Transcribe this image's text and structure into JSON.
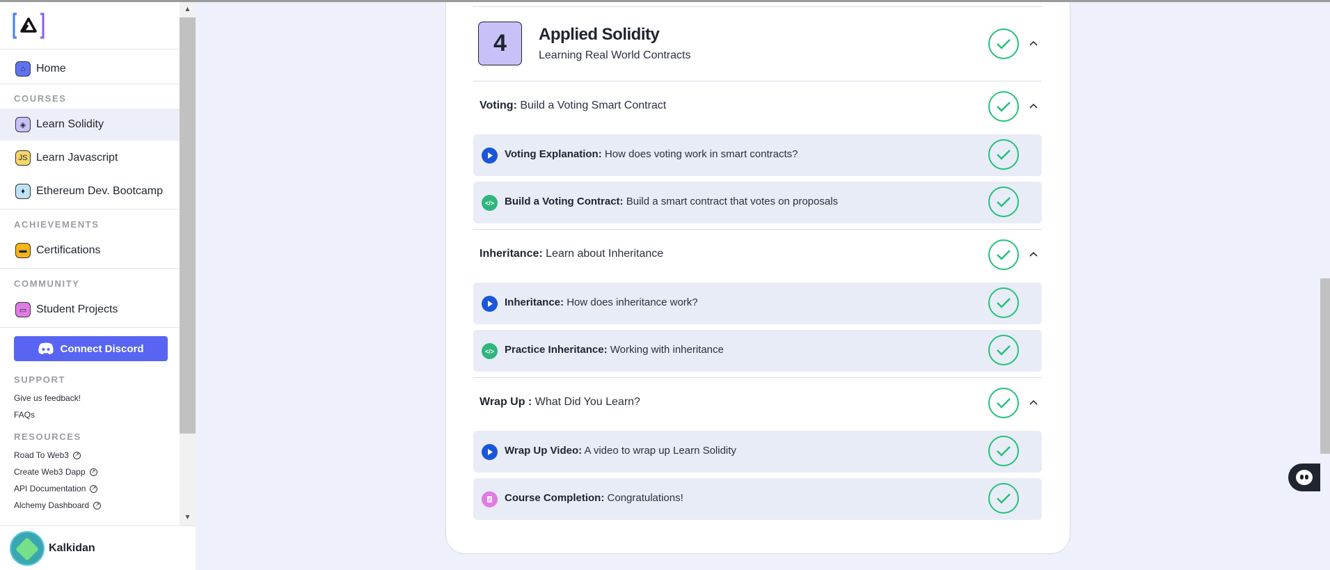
{
  "sidebar": {
    "home": "Home",
    "courses_heading": "COURSES",
    "courses": [
      "Learn Solidity",
      "Learn Javascript",
      "Ethereum Dev. Bootcamp"
    ],
    "achievements_heading": "ACHIEVEMENTS",
    "certifications": "Certifications",
    "community_heading": "COMMUNITY",
    "student_projects": "Student Projects",
    "discord_label": "Connect Discord",
    "support_heading": "SUPPORT",
    "support_links": [
      "Give us feedback!",
      "FAQs"
    ],
    "resources_heading": "RESOURCES",
    "resource_links": [
      "Road To Web3",
      "Create Web3 Dapp",
      "API Documentation",
      "Alchemy Dashboard"
    ],
    "user_name": "Kalkidan"
  },
  "section": {
    "number": "4",
    "title": "Applied Solidity",
    "subtitle": "Learning Real World Contracts"
  },
  "lessons": [
    {
      "label": "Voting:",
      "desc": "Build a Voting Smart Contract",
      "steps": [
        {
          "icon": "play-icon",
          "label": "Voting Explanation:",
          "desc": "How does voting work in smart contracts?"
        },
        {
          "icon": "code-icon",
          "label": "Build a Voting Contract:",
          "desc": "Build a smart contract that votes on proposals"
        }
      ]
    },
    {
      "label": "Inheritance:",
      "desc": "Learn about Inheritance",
      "steps": [
        {
          "icon": "play-icon",
          "label": "Inheritance:",
          "desc": "How does inheritance work?"
        },
        {
          "icon": "code-icon",
          "label": "Practice Inheritance:",
          "desc": "Working with inheritance"
        }
      ]
    },
    {
      "label": "Wrap Up :",
      "desc": "What Did You Learn?",
      "steps": [
        {
          "icon": "play-icon",
          "label": "Wrap Up Video:",
          "desc": "A video to wrap up Learn Solidity"
        },
        {
          "icon": "document-icon",
          "label": "Course Completion:",
          "desc": "Congratulations!"
        }
      ]
    }
  ],
  "colors": {
    "accent_purple": "#c7c1f8",
    "check_green": "#22c27a",
    "discord_blue": "#5865f2",
    "play_blue": "#1a56db"
  }
}
